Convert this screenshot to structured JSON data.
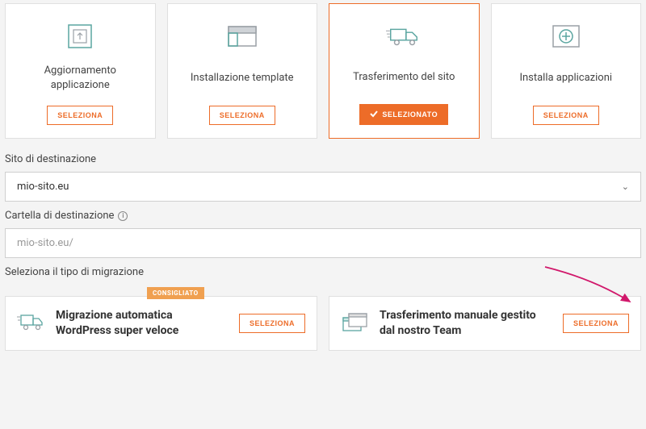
{
  "cards": [
    {
      "title": "Aggiornamento applicazione",
      "button": "SELEZIONA",
      "selected": false
    },
    {
      "title": "Installazione template",
      "button": "SELEZIONA",
      "selected": false
    },
    {
      "title": "Trasferimento del sito",
      "button": "SELEZIONATO",
      "selected": true
    },
    {
      "title": "Installa applicazioni",
      "button": "SELEZIONA",
      "selected": false
    }
  ],
  "dest_site": {
    "label": "Sito di destinazione",
    "value": "mio-sito.eu"
  },
  "dest_folder": {
    "label": "Cartella di destinazione",
    "placeholder": "mio-sito.eu/"
  },
  "migration": {
    "label": "Seleziona il tipo di migrazione",
    "badge": "CONSIGLIATO",
    "options": [
      {
        "title": "Migrazione automatica WordPress super veloce",
        "button": "SELEZIONA"
      },
      {
        "title": "Trasferimento manuale gestito dal nostro Team",
        "button": "SELEZIONA"
      }
    ]
  }
}
